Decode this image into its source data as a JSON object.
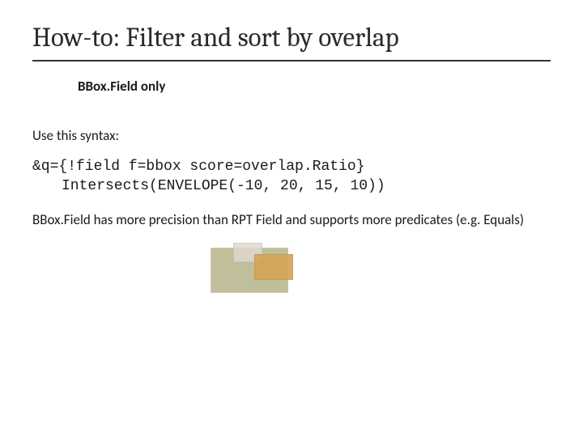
{
  "title": "How-to: Filter and sort by overlap",
  "subtitle": "BBox.Field only",
  "intro": "Use this syntax:",
  "code_line1": "&q={!field f=bbox score=overlap.Ratio}",
  "code_line2": "Intersects(ENVELOPE(-10, 20, 15, 10))",
  "precision": "BBox.Field has more precision than RPT Field and supports more predicates (e.g. Equals)"
}
